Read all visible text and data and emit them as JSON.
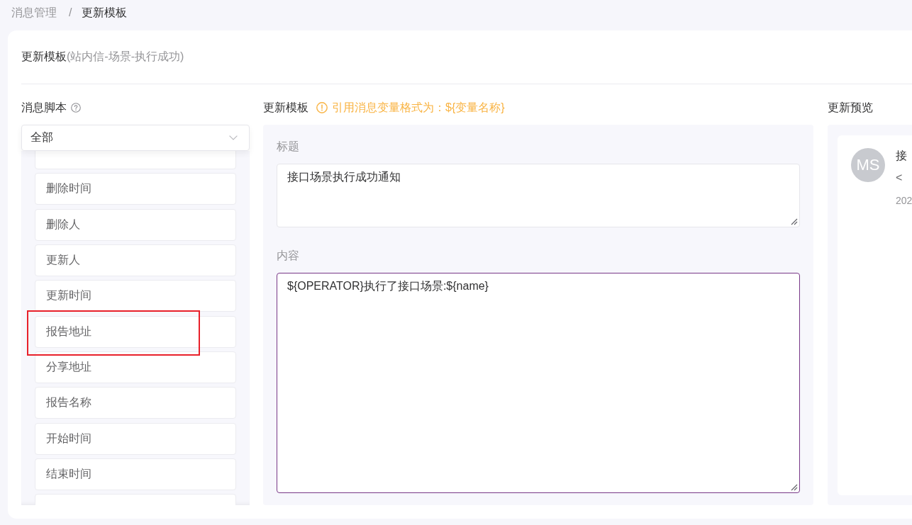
{
  "breadcrumb": {
    "separator": "/",
    "items": [
      {
        "label": "消息管理",
        "current": false
      },
      {
        "label": "更新模板",
        "current": true
      }
    ]
  },
  "card": {
    "title": "更新模板",
    "subtitle": "(站内信-场景-执行成功)"
  },
  "script_panel": {
    "label": "消息脚本",
    "select": {
      "value": "全部"
    },
    "items": [
      {
        "label": "删除时间",
        "annotated": false
      },
      {
        "label": "删除人",
        "annotated": false
      },
      {
        "label": "更新人",
        "annotated": false
      },
      {
        "label": "更新时间",
        "annotated": false
      },
      {
        "label": "报告地址",
        "annotated": true
      },
      {
        "label": "分享地址",
        "annotated": false
      },
      {
        "label": "报告名称",
        "annotated": false
      },
      {
        "label": "开始时间",
        "annotated": false
      },
      {
        "label": "结束时间",
        "annotated": false
      }
    ]
  },
  "template_panel": {
    "label": "更新模板",
    "hint": "引用消息变量格式为：${变量名称}",
    "fields": [
      {
        "label": "标题",
        "value": "接口场景执行成功通知",
        "focused": false
      },
      {
        "label": "内容",
        "value": "${OPERATOR}执行了接口场景:${name}",
        "focused": true
      }
    ]
  },
  "preview_panel": {
    "label": "更新预览",
    "avatar": "MS",
    "lines": [
      {
        "kind": "title",
        "text": "接"
      },
      {
        "kind": "body",
        "text": "<"
      },
      {
        "kind": "time",
        "text": "202"
      }
    ]
  }
}
